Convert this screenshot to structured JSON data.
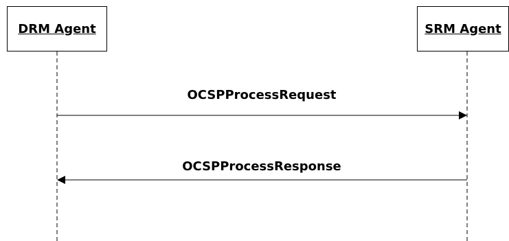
{
  "actors": [
    {
      "label": "DRM Agent"
    },
    {
      "label": "SRM Agent"
    }
  ],
  "messages": [
    {
      "label": "OCSPProcessRequest",
      "from": "DRM Agent",
      "to": "SRM Agent"
    },
    {
      "label": "OCSPProcessResponse",
      "from": "SRM Agent",
      "to": "DRM Agent"
    }
  ],
  "colors": {
    "line": "#000000",
    "background": "#ffffff"
  }
}
